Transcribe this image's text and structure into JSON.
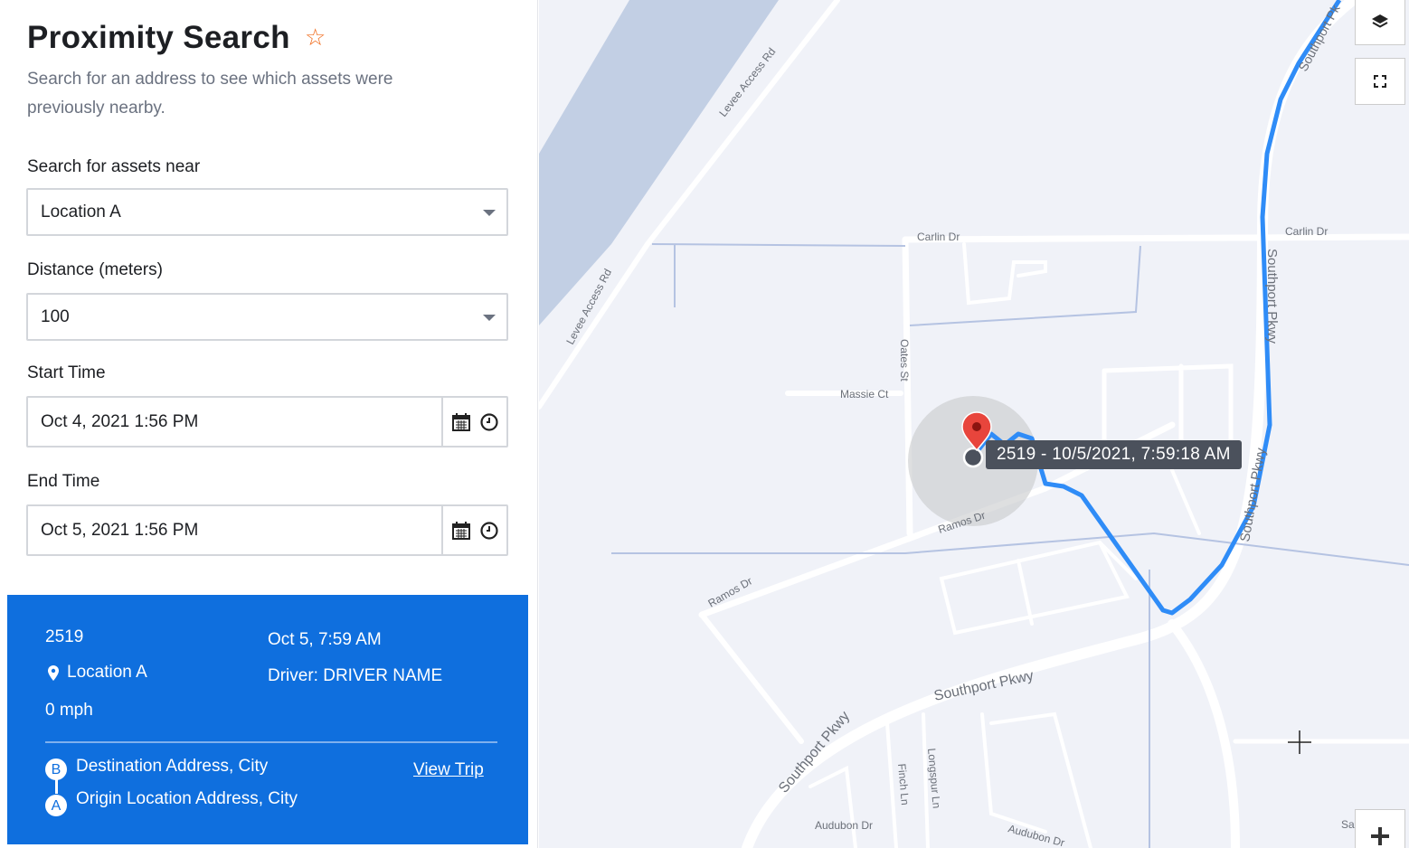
{
  "header": {
    "title": "Proximity Search",
    "favorite_icon": "star-outline-icon",
    "subtitle": "Search for an address to see which assets were previously nearby."
  },
  "form": {
    "near_label": "Search for assets near",
    "near_value": "Location A",
    "distance_label": "Distance (meters)",
    "distance_value": "100",
    "start_label": "Start Time",
    "start_value": "Oct 4, 2021 1:56 PM",
    "end_label": "End Time",
    "end_value": "Oct 5, 2021 1:56 PM"
  },
  "result": {
    "asset": "2519",
    "location": "Location A",
    "speed": "0 mph",
    "time": "Oct 5, 7:59 AM",
    "driver": "Driver: DRIVER NAME",
    "dest_badge": "B",
    "destination": "Destination Address, City",
    "origin_badge": "A",
    "origin": "Origin Location Address, City",
    "view_trip": "View Trip",
    "color": "#0f6fde"
  },
  "map": {
    "tooltip": "2519 - 10/5/2021, 7:59:18 AM",
    "route_color": "#2f8cf7",
    "marker_color": "#e8453c",
    "streets": {
      "levee1": "Levee Access Rd",
      "levee2": "Levee Access Rd",
      "carlin1": "Carlin Dr",
      "carlin2": "Carlin Dr",
      "southport1": "Southport Pkwy",
      "southport2": "Southport Pkwy",
      "southport3": "Southport Pkwy",
      "southport4": "Southport Pkwy",
      "southport5": "Southport Pk",
      "oates": "Oates St",
      "massie": "Massie Ct",
      "ramos1": "Ramos Dr",
      "ramos2": "Ramos Dr",
      "finch": "Finch Ln",
      "longspur": "Longspur Ln",
      "audubon1": "Audubon Dr",
      "audubon2": "Audubon Dr",
      "sa": "Sa"
    }
  }
}
